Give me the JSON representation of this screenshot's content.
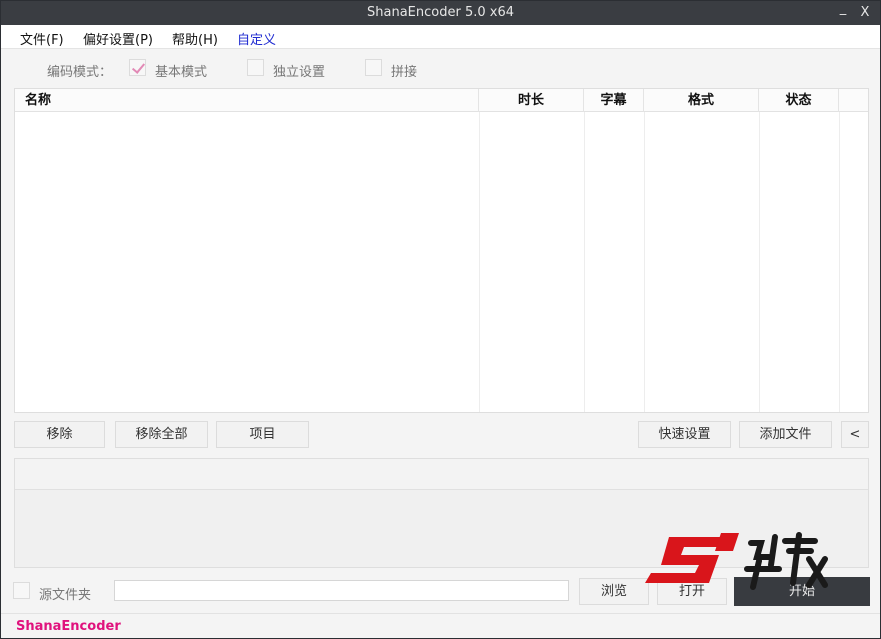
{
  "window": {
    "title": "ShanaEncoder 5.0 x64",
    "minimize_glyph": "_",
    "close_glyph": "X"
  },
  "menu": {
    "file": "文件(F)",
    "preferences": "偏好设置(P)",
    "help": "帮助(H)",
    "custom": "自定义"
  },
  "mode": {
    "label": "编码模式：",
    "options": [
      {
        "label": "基本模式",
        "checked": true
      },
      {
        "label": "独立设置",
        "checked": false
      },
      {
        "label": "拼接",
        "checked": false
      }
    ]
  },
  "table": {
    "columns": [
      "名称",
      "时长",
      "字幕",
      "格式",
      "状态"
    ],
    "rows": []
  },
  "buttons": {
    "remove": "移除",
    "remove_all": "移除全部",
    "item": "项目",
    "quick_settings": "快速设置",
    "add_file": "添加文件",
    "collapse": "<",
    "browse": "浏览",
    "open": "打开",
    "start": "开始"
  },
  "output": {
    "source_folder_label": "源文件夹",
    "source_folder_checked": false,
    "path_value": ""
  },
  "status": {
    "brand": "ShanaEncoder"
  },
  "colors": {
    "titlebar": "#3a3d42",
    "brand": "#e0127d",
    "custom_menu": "#1f2bd1",
    "check_mark": "#e28ab6",
    "watermark_red": "#d9151b"
  }
}
